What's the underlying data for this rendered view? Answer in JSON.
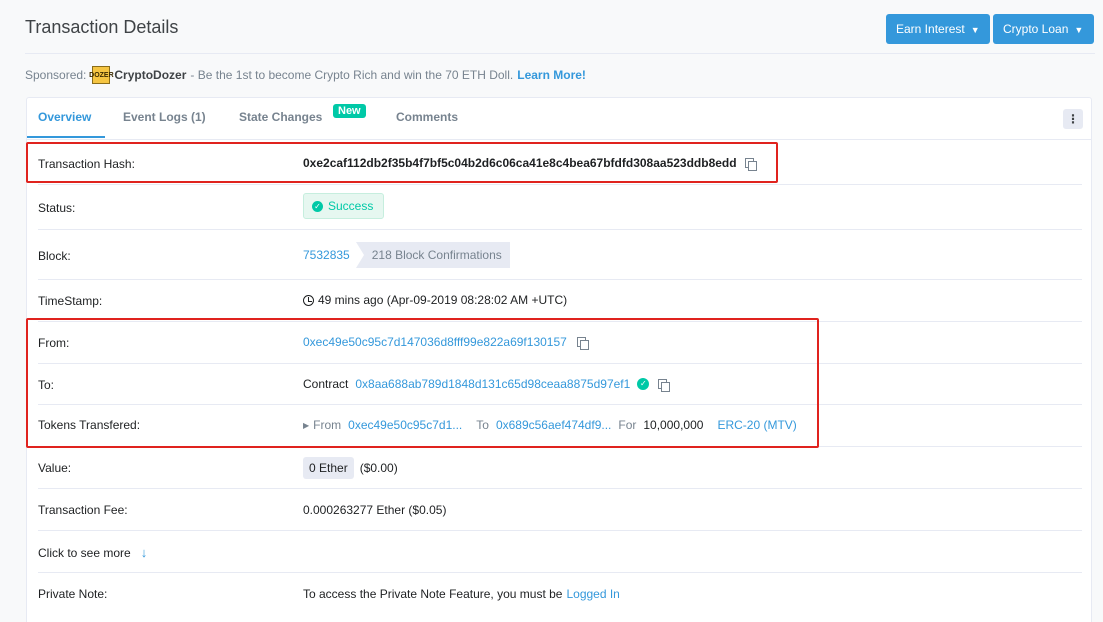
{
  "header": {
    "title": "Transaction Details",
    "earn_interest": "Earn Interest",
    "crypto_loan": "Crypto Loan"
  },
  "sponsored": {
    "prefix": "Sponsored:",
    "logo_text": "DOZER",
    "name": "CryptoDozer",
    "text": "- Be the 1st to become Crypto Rich and win the 70 ETH Doll.",
    "learn_more": "Learn More!"
  },
  "tabs": {
    "overview": "Overview",
    "event_logs": "Event Logs (1)",
    "state_changes": "State Changes",
    "new_badge": "New",
    "comments": "Comments",
    "more_menu": "⋮"
  },
  "details": {
    "tx_hash_label": "Transaction Hash:",
    "tx_hash": "0xe2caf112db2f35b4f7bf5c04b2d6c06ca41e8c4bea67bfdfd308aa523ddb8edd",
    "status_label": "Status:",
    "status": "Success",
    "block_label": "Block:",
    "block": "7532835",
    "confirmations": "218 Block Confirmations",
    "timestamp_label": "TimeStamp:",
    "timestamp": "49 mins ago (Apr-09-2019 08:28:02 AM +UTC)",
    "from_label": "From:",
    "from": "0xec49e50c95c7d147036d8fff99e822a69f130157",
    "to_label": "To:",
    "to_prefix": "Contract",
    "to": "0x8aa688ab789d1848d131c65d98ceaa8875d97ef1",
    "tokens_label": "Tokens Transfered:",
    "tokens_from_word": "From",
    "tokens_from": "0xec49e50c95c7d1...",
    "tokens_to_word": "To",
    "tokens_to": "0x689c56aef474df9...",
    "tokens_for_word": "For",
    "tokens_amount": "10,000,000",
    "tokens_token": "ERC-20 (MTV)",
    "value_label": "Value:",
    "value": "0 Ether",
    "value_usd": "($0.00)",
    "fee_label": "Transaction Fee:",
    "fee": "0.000263277 Ether ($0.05)",
    "see_more": "Click to see more",
    "private_note_label": "Private Note:",
    "private_note_text": "To access the Private Note Feature, you must be",
    "logged_in": "Logged In"
  },
  "colors": {
    "accent": "#3498db",
    "success": "#00c9a7",
    "highlight_box": "#e0231e"
  }
}
